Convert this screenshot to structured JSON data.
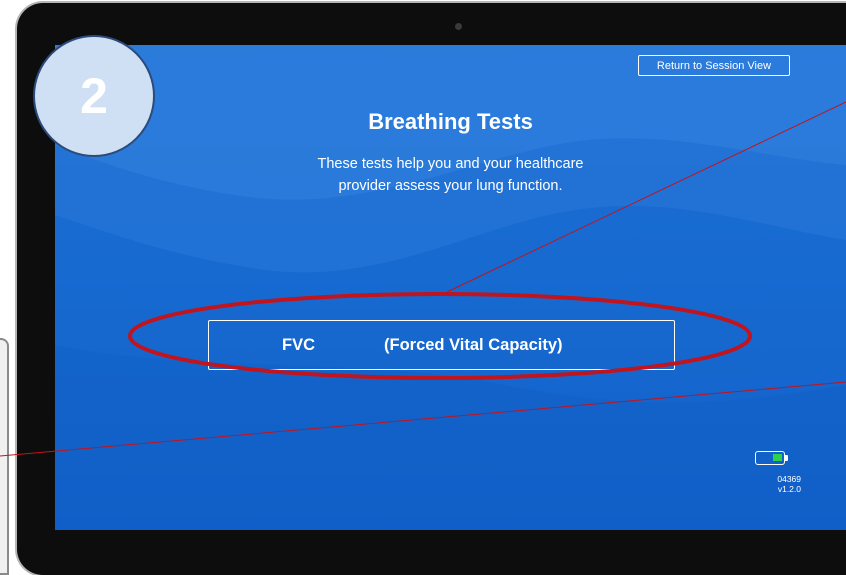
{
  "step_badge": {
    "number": "2"
  },
  "header": {
    "return_button_label": "Return to Session View"
  },
  "main": {
    "title": "Breathing Tests",
    "subtitle_line1": "These tests help you and your healthcare",
    "subtitle_line2": "provider assess your lung function."
  },
  "tests": [
    {
      "abbreviation": "FVC",
      "full_name": "(Forced Vital Capacity)"
    }
  ],
  "status": {
    "battery_icon": "battery-icon",
    "battery_fill_color": "#2fd14a",
    "device_id": "04369",
    "version": "v1.2.0"
  },
  "annotation": {
    "highlight_color": "#c0141e",
    "line_color": "#c0141e"
  }
}
